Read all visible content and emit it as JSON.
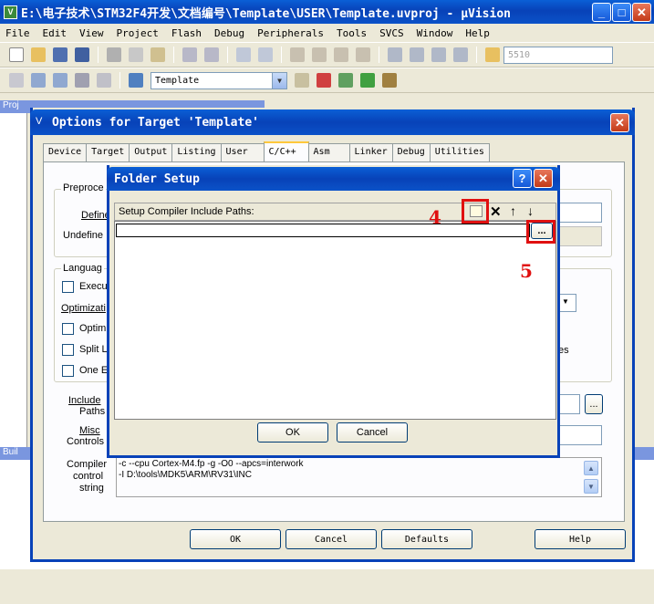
{
  "window": {
    "title": "E:\\电子技术\\STM32F4开发\\文档编号\\Template\\USER\\Template.uvproj - µVision"
  },
  "menu": [
    "File",
    "Edit",
    "View",
    "Project",
    "Flash",
    "Debug",
    "Peripherals",
    "Tools",
    "SVCS",
    "Window",
    "Help"
  ],
  "toolbar": {
    "search_value": "5510",
    "target_combo": "Template"
  },
  "panes": {
    "project_label": "Proj",
    "build_label": "Buil"
  },
  "options_dialog": {
    "title": "Options for Target 'Template'",
    "tabs": [
      "Device",
      "Target",
      "Output",
      "Listing",
      "User",
      "C/C++",
      "Asm",
      "Linker",
      "Debug",
      "Utilities"
    ],
    "active_tab": "C/C++",
    "preprocessor_group": "Preproce",
    "define_label": "Define",
    "undefine_label": "Undefine",
    "language_group": "Languag",
    "execute_label": "Execu",
    "optimization_label": "Optimizati",
    "optim_label": "Optim",
    "split_label": "Split L",
    "one_label": "One E",
    "right_es": "es",
    "include_label": "Include",
    "paths_label": "Paths",
    "misc_label": "Misc",
    "controls_label": "Controls",
    "compiler_label": "Compiler",
    "control_label": "control",
    "string_label": "string",
    "compiler_string_line1": "-c --cpu Cortex-M4.fp -g -O0 --apcs=interwork",
    "compiler_string_line2": "-I D:\\tools\\MDK5\\ARM\\RV31\\INC",
    "ok": "OK",
    "cancel": "Cancel",
    "defaults": "Defaults",
    "help": "Help",
    "browse": "..."
  },
  "folder_setup": {
    "title": "Folder Setup",
    "header": "Setup Compiler Include Paths:",
    "browse": "...",
    "ok": "OK",
    "cancel": "Cancel",
    "help_glyph": "?",
    "close_glyph": "✕"
  },
  "annotations": {
    "four": "4",
    "five": "5"
  },
  "colors": {
    "title_blue": "#0842b8",
    "highlight_red": "#e01010",
    "tab_active": "#ffc83c"
  }
}
